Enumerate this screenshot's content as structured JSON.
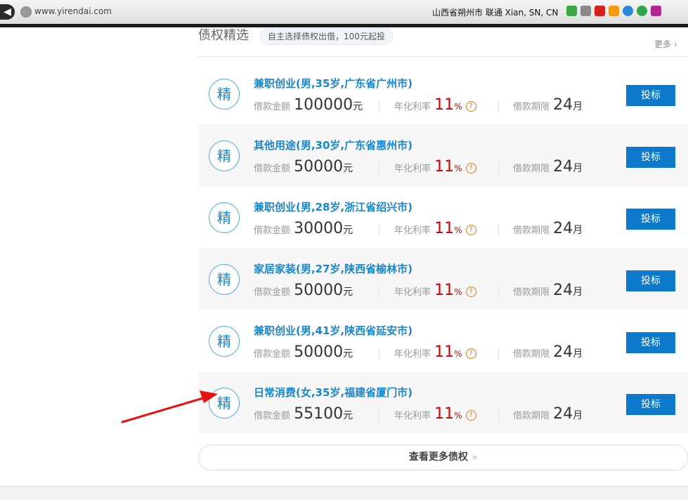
{
  "browser": {
    "back_icon": "back-arrow-icon",
    "url": "www.yirendai.com",
    "geo_info": "山西省朔州市 联通   Xian, SN, CN"
  },
  "section": {
    "title": "债权精选",
    "subtitle": "自主选择债权出借，100元起投",
    "more_label": "更多"
  },
  "labels": {
    "amount": "借款金额",
    "rate": "年化利率",
    "term": "借款期限",
    "amount_unit": "元",
    "rate_unit": "%",
    "term_unit": "月",
    "badge": "精",
    "bid": "投标",
    "help": "?"
  },
  "loans": [
    {
      "title": "兼职创业(男,35岁,广东省广州市)",
      "amount": "100000",
      "rate": "11",
      "term": "24"
    },
    {
      "title": "其他用途(男,30岁,广东省惠州市)",
      "amount": "50000",
      "rate": "11",
      "term": "24"
    },
    {
      "title": "兼职创业(男,28岁,浙江省绍兴市)",
      "amount": "30000",
      "rate": "11",
      "term": "24"
    },
    {
      "title": "家居家装(男,27岁,陕西省榆林市)",
      "amount": "50000",
      "rate": "11",
      "term": "24"
    },
    {
      "title": "兼职创业(男,41岁,陕西省延安市)",
      "amount": "50000",
      "rate": "11",
      "term": "24"
    },
    {
      "title": "日常消费(女,35岁,福建省厦门市)",
      "amount": "55100",
      "rate": "11",
      "term": "24"
    }
  ],
  "footer": {
    "view_more": "查看更多债权",
    "chevron": "»"
  },
  "colors": {
    "accent": "#0c79cd",
    "title_blue": "#1a86cc",
    "rate_red": "#cc0000",
    "help_orange": "#e07a00",
    "annotation_arrow": "#e81010"
  }
}
